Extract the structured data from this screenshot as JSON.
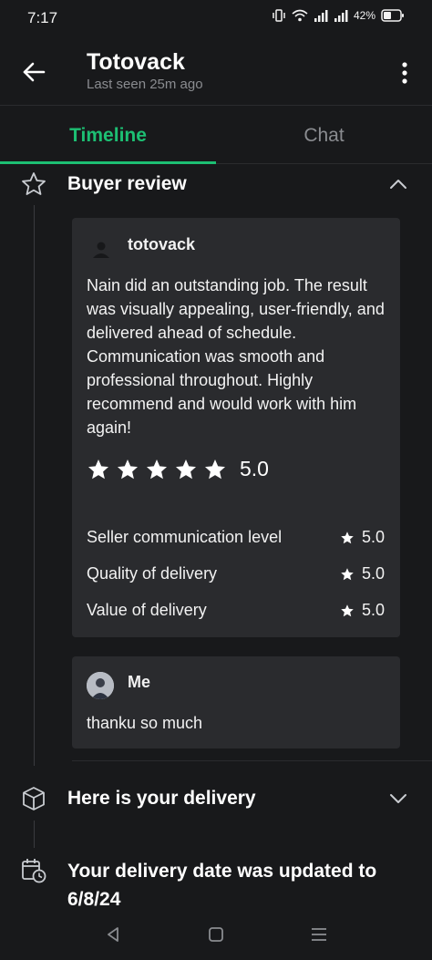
{
  "status_bar": {
    "time": "7:17",
    "battery": "42%"
  },
  "header": {
    "contact_name": "Totovack",
    "last_seen": "Last seen 25m ago"
  },
  "tabs": [
    {
      "label": "Timeline",
      "active": true
    },
    {
      "label": "Chat",
      "active": false
    }
  ],
  "timeline": {
    "buyer_review": {
      "title": "Buyer review",
      "expanded": true,
      "reviewer": "totovack",
      "text": "Nain did an outstanding job. The result was visually appealing, user-friendly, and delivered ahead of schedule. Communication was smooth and professional throughout. Highly recommend and would work with him again!",
      "stars": 5,
      "overall_rating": "5.0",
      "ratings": [
        {
          "label": "Seller communication level",
          "value": "5.0"
        },
        {
          "label": "Quality of delivery",
          "value": "5.0"
        },
        {
          "label": "Value of delivery",
          "value": "5.0"
        }
      ],
      "reply": {
        "author": "Me",
        "text": "thanku so much"
      }
    },
    "delivery": {
      "title": "Here is your delivery",
      "expanded": false
    },
    "date_update": {
      "title": "Your delivery date was updated to 6/8/24"
    }
  },
  "colors": {
    "accent": "#1dbf73",
    "background": "#18191b",
    "card": "#2a2b2e",
    "muted_text": "#8a8c90"
  },
  "icons": {
    "back": "arrow-left-icon",
    "more": "more-vertical-icon",
    "review": "star-outline-icon",
    "delivery": "package-icon",
    "date": "calendar-clock-icon"
  }
}
